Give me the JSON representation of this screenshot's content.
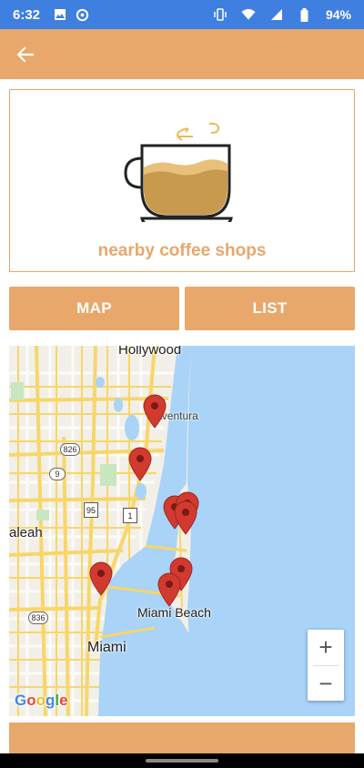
{
  "status_bar": {
    "time": "6:32",
    "battery_percent": "94%",
    "icons": [
      "image-icon",
      "data-saver-icon",
      "vibrate-icon",
      "wifi-icon",
      "signal-icon",
      "battery-icon"
    ]
  },
  "app_bar": {
    "back_icon": "arrow-left-icon"
  },
  "hero": {
    "title": "nearby coffee shops",
    "icon": "coffee-cup-icon"
  },
  "tabs": {
    "map_label": "MAP",
    "list_label": "LIST"
  },
  "map": {
    "labels": {
      "hollywood": "Hollywood",
      "aventura": "Aventura",
      "hialeah": "aleah",
      "miami_beach": "Miami Beach",
      "miami": "Miami"
    },
    "shields": {
      "r826": "826",
      "r9": "9",
      "i95": "95",
      "us1": "1",
      "r836": "836"
    },
    "zoom_in": "+",
    "zoom_out": "−",
    "attribution": "Google",
    "marker_count": 9
  },
  "colors": {
    "accent": "#e8a76b",
    "status_bar": "#3f7fe0",
    "ocean": "#a9d3f7",
    "pin": "#d23a30"
  }
}
